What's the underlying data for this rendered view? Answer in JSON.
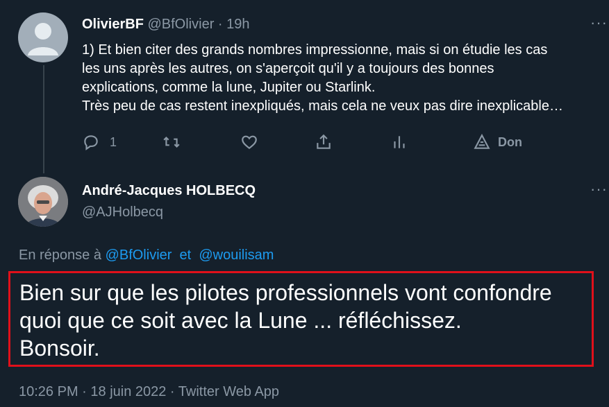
{
  "tweet1": {
    "display_name": "OlivierBF",
    "handle": "@BfOlivier",
    "separator": " · ",
    "time_ago": "19h",
    "more": "···",
    "text_lines": [
      "1) Et bien citer des grands nombres impressionne, mais si on étudie les cas",
      "les uns après les autres, on s'aperçoit qu'il y a toujours des bonnes",
      "explications, comme la lune, Jupiter ou Starlink.",
      "Très peu de cas restent inexpliqués, mais cela ne veux pas dire inexplicable…"
    ],
    "actions": {
      "reply_icon": "reply-icon",
      "reply_count": "1",
      "retweet_icon": "retweet-icon",
      "like_icon": "heart-icon",
      "share_icon": "share-icon",
      "analytics_icon": "analytics-icon",
      "donate_icon": "donate-icon",
      "donate_label": "Don"
    }
  },
  "tweet2": {
    "display_name": "André-Jacques HOLBECQ",
    "handle": "@AJHolbecq",
    "more": "···",
    "reply_prefix": "En réponse à",
    "reply_handles": [
      "@BfOlivier",
      "@wouilisam"
    ],
    "reply_joiner": "et",
    "text_lines": [
      "Bien sur que les pilotes professionnels vont confondre",
      "quoi que ce soit avec la Lune ... réfléchissez.",
      "Bonsoir."
    ],
    "time": "10:26 PM",
    "date": "18 juin 2022",
    "source": "Twitter Web App",
    "meta_separator": " · "
  },
  "colors": {
    "background": "#15202b",
    "text": "#ffffff",
    "muted": "#8b98a5",
    "link": "#1d9bf0",
    "highlight_border": "#e0101a"
  }
}
